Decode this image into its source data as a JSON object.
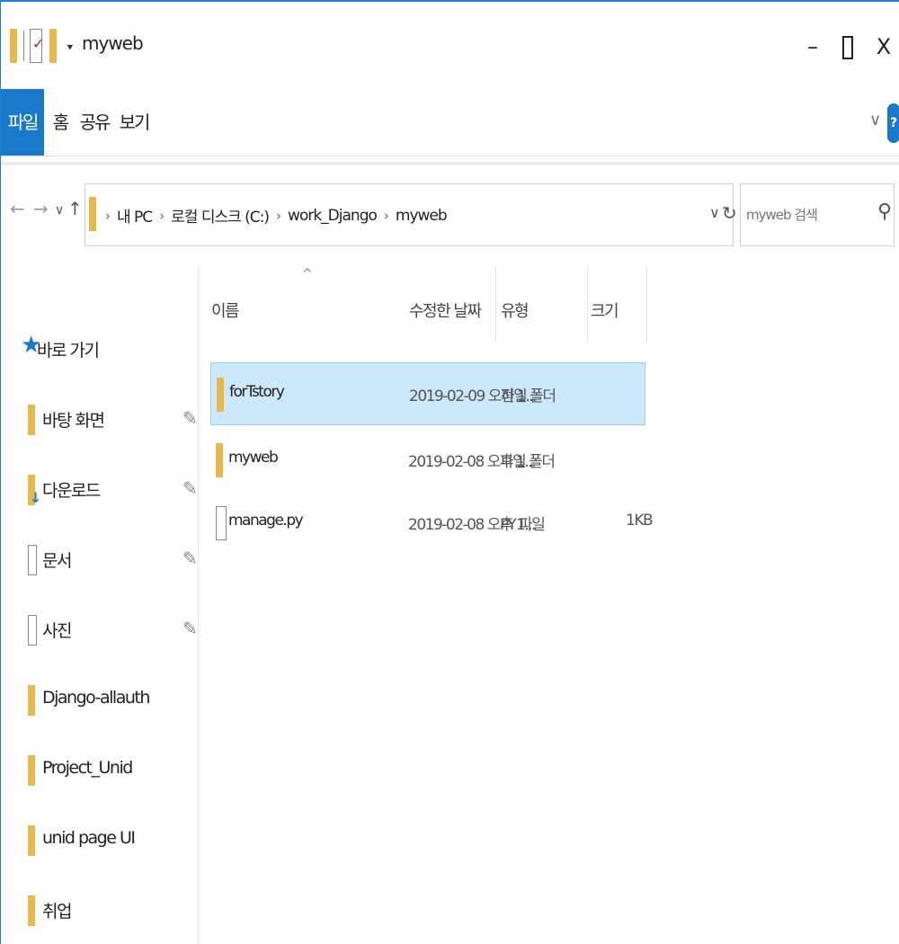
{
  "window": {
    "title": "myweb",
    "qat_dropdown": "⯆",
    "minimize": "–",
    "close": "X"
  },
  "ribbon": {
    "tabs": [
      {
        "label": "파일",
        "active": true
      },
      {
        "label": "홈",
        "active": false
      },
      {
        "label": "공유",
        "active": false
      },
      {
        "label": "보기",
        "active": false
      }
    ],
    "expand": "∨",
    "help": "?"
  },
  "nav": {
    "back": "←",
    "forward": "→",
    "recent": "∨",
    "up": "↑",
    "breadcrumb": [
      "내 PC",
      "로컬 디스크 (C:)",
      "work_Django",
      "myweb"
    ],
    "crumb_sep": "›",
    "address_dropdown": "∨",
    "refresh": "↻",
    "search_placeholder": "myweb 검색",
    "search_icon": "search-icon"
  },
  "sidebar": {
    "quick_access": "바로 가기",
    "items": [
      {
        "label": "바탕 화면",
        "pinned": true,
        "icon": "desktop-folder-icon"
      },
      {
        "label": "다운로드",
        "pinned": true,
        "icon": "download-folder-icon"
      },
      {
        "label": "문서",
        "pinned": true,
        "icon": "document-icon"
      },
      {
        "label": "사진",
        "pinned": true,
        "icon": "picture-icon"
      },
      {
        "label": "Django-allauth",
        "pinned": false,
        "icon": "folder-icon"
      },
      {
        "label": "Project_Unid",
        "pinned": false,
        "icon": "folder-icon"
      },
      {
        "label": "unid page UI",
        "pinned": false,
        "icon": "folder-icon"
      },
      {
        "label": "취업",
        "pinned": false,
        "icon": "folder-icon"
      }
    ]
  },
  "columns": {
    "name": "이름",
    "modified": "수정한 날짜",
    "type": "유형",
    "size": "크기",
    "sort_indicator": "^"
  },
  "files": [
    {
      "name": "forTstory",
      "modified": "2019-02-09 오전 1...",
      "type": "파일 폴더",
      "size": "",
      "kind": "folder",
      "selected": true
    },
    {
      "name": "myweb",
      "modified": "2019-02-08 오후 1...",
      "type": "파일 폴더",
      "size": "",
      "kind": "folder",
      "selected": false
    },
    {
      "name": "manage.py",
      "modified": "2019-02-08 오후 1...",
      "type": "PY 파일",
      "size": "1KB",
      "kind": "file",
      "selected": false
    }
  ],
  "colors": {
    "accent": "#1979ca",
    "folder": "#e8b84b",
    "selection": "#cce8fa"
  }
}
